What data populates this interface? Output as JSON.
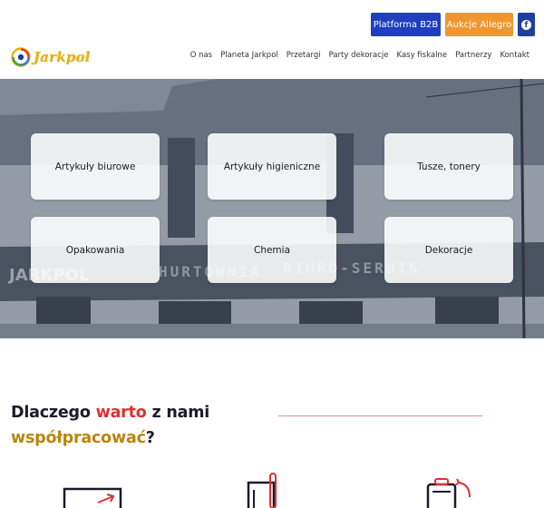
{
  "header": {
    "b2b_label": "Platforma B2B",
    "allegro_label": "Aukcje Allegro",
    "facebook_icon": "facebook-icon",
    "logo_text": "Jarkpol",
    "nav": [
      "O nas",
      "Planeta Jarkpol",
      "Przetargi",
      "Party dekoracje",
      "Kasy fiskalne",
      "Partnerzy",
      "Kontakt"
    ]
  },
  "hero": {
    "tiles": [
      "Artykuły biurowe",
      "Artykuły higieniczne",
      "Tusze, tonery",
      "Opakowania",
      "Chemia",
      "Dekoracje"
    ],
    "sign_left": "JARKPOL",
    "sign_mid": "HURTOWNIA",
    "sign_right": "BIURO-SERWIS"
  },
  "why": {
    "part1": "Dlaczego ",
    "highlight": "warto",
    "part2": " z nami",
    "line2": "współpracować",
    "q": "?"
  },
  "colors": {
    "b2b": "#1f3fbf",
    "allegro": "#f0962e",
    "accent_red": "#e03030",
    "logo_gold": "#e8b40f"
  }
}
